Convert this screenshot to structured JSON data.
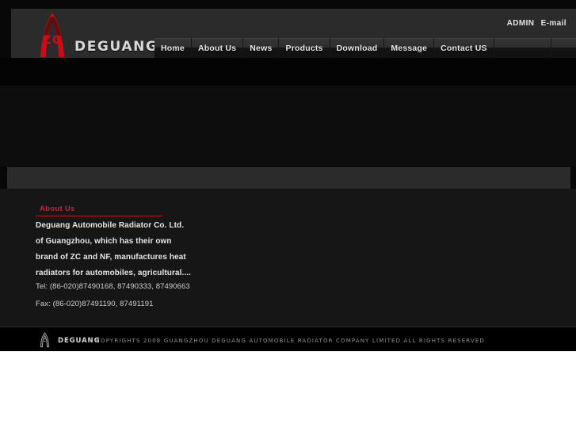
{
  "header": {
    "logo": {
      "mark_icon": "deguang-logo-icon",
      "mark_letters": "ZC",
      "wordmark": "DEGUANG"
    },
    "top_links": [
      {
        "label": "ADMIN",
        "name": "admin-link"
      },
      {
        "label": "E-mail",
        "name": "email-link"
      }
    ],
    "nav": [
      {
        "label": "Home"
      },
      {
        "label": "About Us"
      },
      {
        "label": "News"
      },
      {
        "label": "Products"
      },
      {
        "label": "Download"
      },
      {
        "label": "Message"
      },
      {
        "label": "Contact US"
      },
      {
        "label": ""
      },
      {
        "label": ""
      },
      {
        "label": ""
      }
    ]
  },
  "about": {
    "title": "About Us",
    "lines": [
      "Deguang Automobile Radiator Co. Ltd.",
      "of Guangzhou, which has their own",
      "brand of ZC and NF, manufactures heat",
      "radiators for automobiles, agricultural...."
    ]
  },
  "contact": {
    "tel": "Tel: (86-020)87490168, 87490333, 87490663",
    "fax": "Fax: (86-020)87491190, 87491191"
  },
  "footer": {
    "mark_icon": "deguang-logo-icon",
    "wordmark": "DEGUANG",
    "copyright": "COPYRIGHTS 2008 GUANGZHOU DEGUANG AUTOMOBILE RADIATOR COMPANY LIMITED.ALL RIGHTS RESERVED"
  },
  "colors": {
    "accent_red": "#d02033",
    "page_bg": "#080808",
    "panel_bg": "#2b2b2b",
    "content_bg": "#161616"
  }
}
